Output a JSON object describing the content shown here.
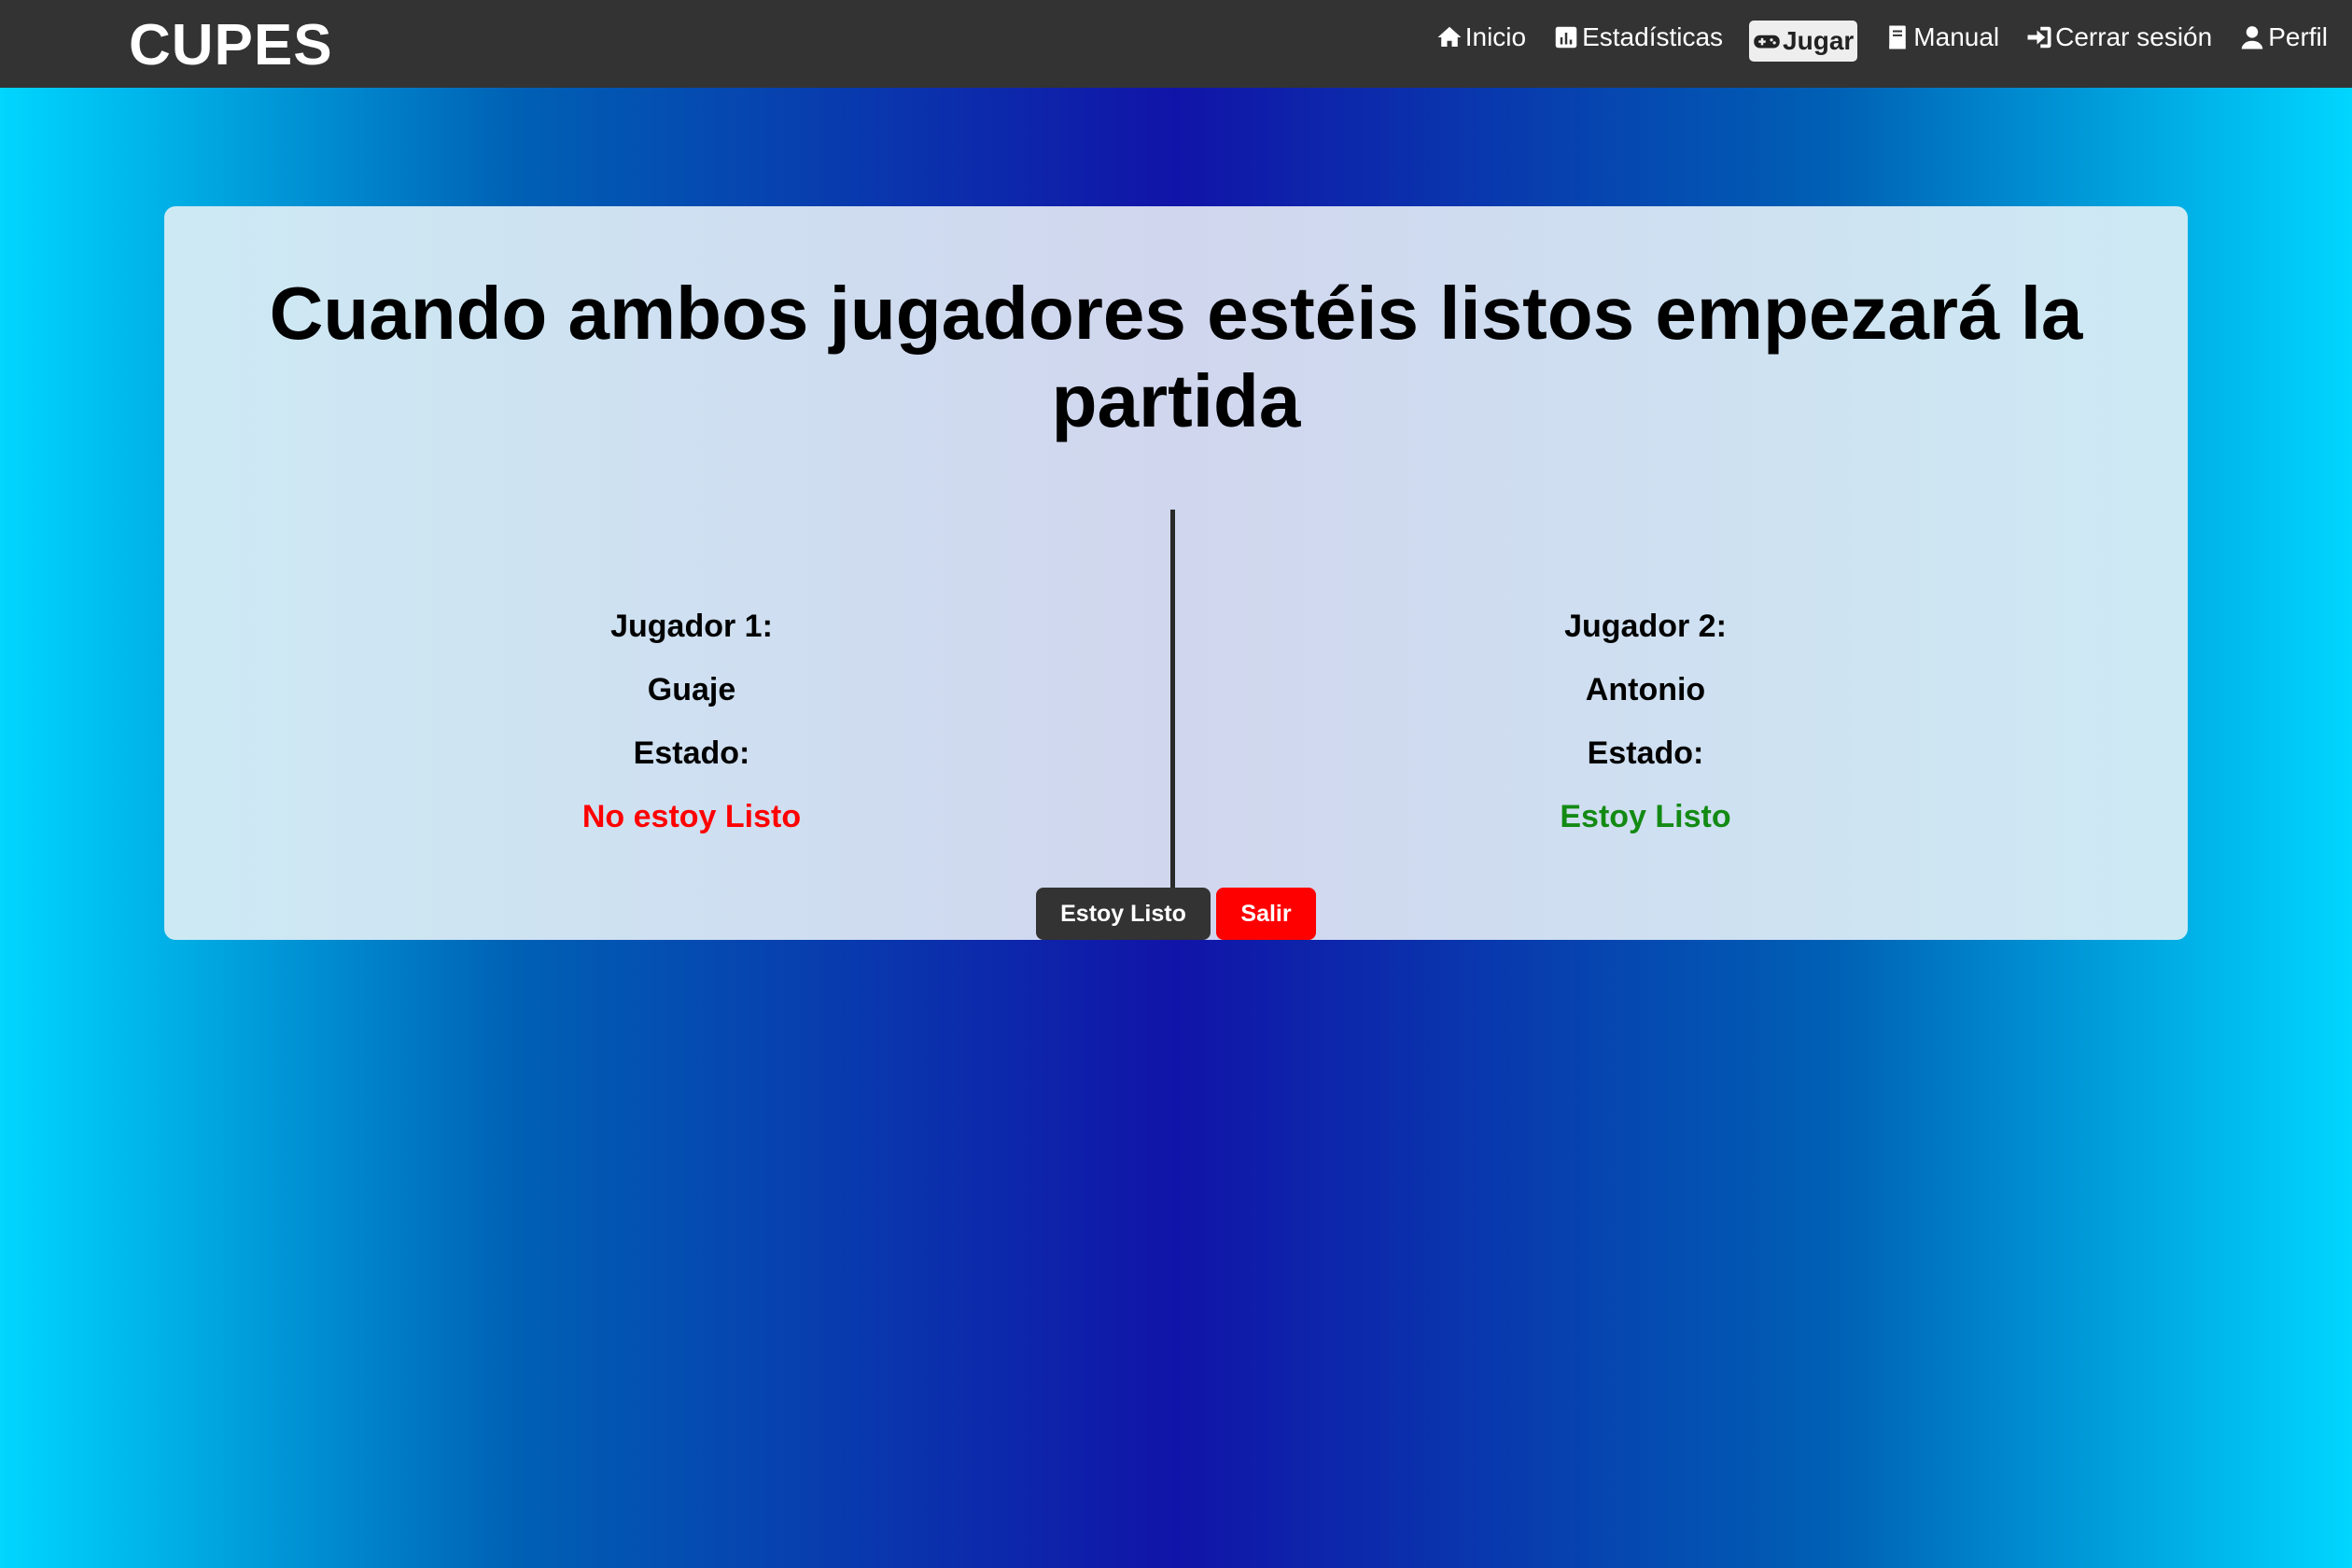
{
  "navbar": {
    "brand": "CUPES",
    "items": [
      {
        "label": "Inicio",
        "icon": "home-icon"
      },
      {
        "label": "Estadísticas",
        "icon": "chart-icon"
      },
      {
        "label": "Jugar",
        "icon": "gamepad-icon",
        "active": true
      },
      {
        "label": "Manual",
        "icon": "book-icon"
      },
      {
        "label": "Cerrar sesión",
        "icon": "logout-icon"
      },
      {
        "label": "Perfil",
        "icon": "user-icon"
      }
    ]
  },
  "lobby": {
    "title": "Cuando ambos jugadores estéis listos empezará la partida",
    "players": [
      {
        "heading": "Jugador 1:",
        "name": "Guaje",
        "state_label": "Estado:",
        "status": "No estoy Listo",
        "status_color": "#ff0000"
      },
      {
        "heading": "Jugador 2:",
        "name": "Antonio",
        "state_label": "Estado:",
        "status": "Estoy Listo",
        "status_color": "#138a14"
      }
    ],
    "buttons": {
      "ready": "Estoy Listo",
      "exit": "Salir"
    }
  },
  "colors": {
    "navbar": "#333333",
    "exit_button": "#ff0000",
    "ready_button": "#333333"
  }
}
